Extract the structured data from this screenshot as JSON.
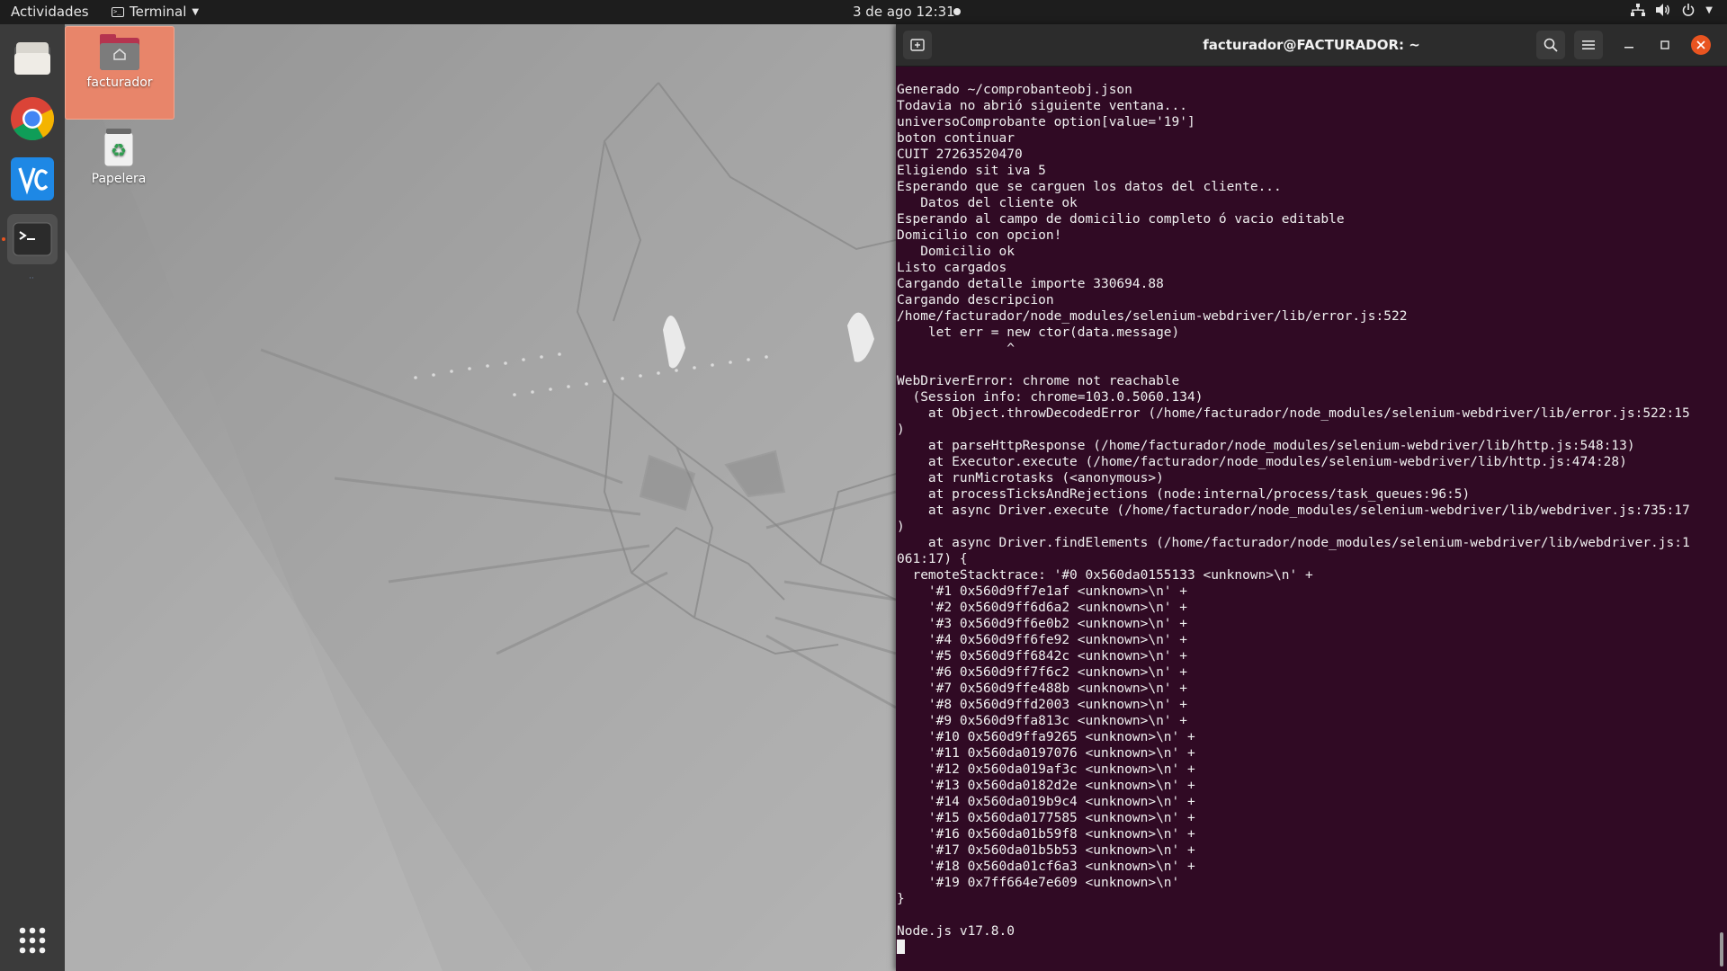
{
  "topbar": {
    "activities": "Actividades",
    "app_menu": "Terminal",
    "clock": "3 de ago  12:31"
  },
  "dock": {
    "items": [
      {
        "name": "Files",
        "icon": "files-icon"
      },
      {
        "name": "Google Chrome",
        "icon": "chrome-icon"
      },
      {
        "name": "VS Code",
        "icon": "vscode-icon"
      },
      {
        "name": "Terminal",
        "icon": "terminal-icon"
      }
    ],
    "show_apps_icon": "app-grid-icon"
  },
  "desktop": {
    "icons": [
      {
        "label": "facturador",
        "icon": "home-folder-icon"
      },
      {
        "label": "Papelera",
        "icon": "trash-icon"
      }
    ]
  },
  "terminal": {
    "title": "facturador@FACTURADOR: ~",
    "lines": [
      "Generado ~/comprobanteobj.json",
      "Todavia no abrió siguiente ventana...",
      "universoComprobante option[value='19']",
      "boton continuar",
      "CUIT 27263520470",
      "Eligiendo sit iva 5",
      "Esperando que se carguen los datos del cliente...",
      "   Datos del cliente ok",
      "Esperando al campo de domicilio completo ó vacio editable",
      "Domicilio con opcion!",
      "   Domicilio ok",
      "Listo cargados",
      "Cargando detalle importe 330694.88",
      "Cargando descripcion",
      "/home/facturador/node_modules/selenium-webdriver/lib/error.js:522",
      "    let err = new ctor(data.message)",
      "              ^",
      "",
      "WebDriverError: chrome not reachable",
      "  (Session info: chrome=103.0.5060.134)",
      "    at Object.throwDecodedError (/home/facturador/node_modules/selenium-webdriver/lib/error.js:522:15",
      ")",
      "    at parseHttpResponse (/home/facturador/node_modules/selenium-webdriver/lib/http.js:548:13)",
      "    at Executor.execute (/home/facturador/node_modules/selenium-webdriver/lib/http.js:474:28)",
      "    at runMicrotasks (<anonymous>)",
      "    at processTicksAndRejections (node:internal/process/task_queues:96:5)",
      "    at async Driver.execute (/home/facturador/node_modules/selenium-webdriver/lib/webdriver.js:735:17",
      ")",
      "    at async Driver.findElements (/home/facturador/node_modules/selenium-webdriver/lib/webdriver.js:1",
      "061:17) {",
      "  remoteStacktrace: '#0 0x560da0155133 <unknown>\\n' +",
      "    '#1 0x560d9ff7e1af <unknown>\\n' +",
      "    '#2 0x560d9ff6d6a2 <unknown>\\n' +",
      "    '#3 0x560d9ff6e0b2 <unknown>\\n' +",
      "    '#4 0x560d9ff6fe92 <unknown>\\n' +",
      "    '#5 0x560d9ff6842c <unknown>\\n' +",
      "    '#6 0x560d9ff7f6c2 <unknown>\\n' +",
      "    '#7 0x560d9ffe488b <unknown>\\n' +",
      "    '#8 0x560d9ffd2003 <unknown>\\n' +",
      "    '#9 0x560d9ffa813c <unknown>\\n' +",
      "    '#10 0x560d9ffa9265 <unknown>\\n' +",
      "    '#11 0x560da0197076 <unknown>\\n' +",
      "    '#12 0x560da019af3c <unknown>\\n' +",
      "    '#13 0x560da0182d2e <unknown>\\n' +",
      "    '#14 0x560da019b9c4 <unknown>\\n' +",
      "    '#15 0x560da0177585 <unknown>\\n' +",
      "    '#16 0x560da01b59f8 <unknown>\\n' +",
      "    '#17 0x560da01b5b53 <unknown>\\n' +",
      "    '#18 0x560da01cf6a3 <unknown>\\n' +",
      "    '#19 0x7ff664e7e609 <unknown>\\n'",
      "}",
      "",
      "Node.js v17.8.0"
    ]
  },
  "colors": {
    "terminal_bg": "#300a24",
    "titlebar_bg": "#2c2c2c",
    "topbar_bg": "#1d1d1d",
    "dock_bg": "#3b3b3b",
    "accent": "#e95420",
    "close_button": "#e95420"
  }
}
